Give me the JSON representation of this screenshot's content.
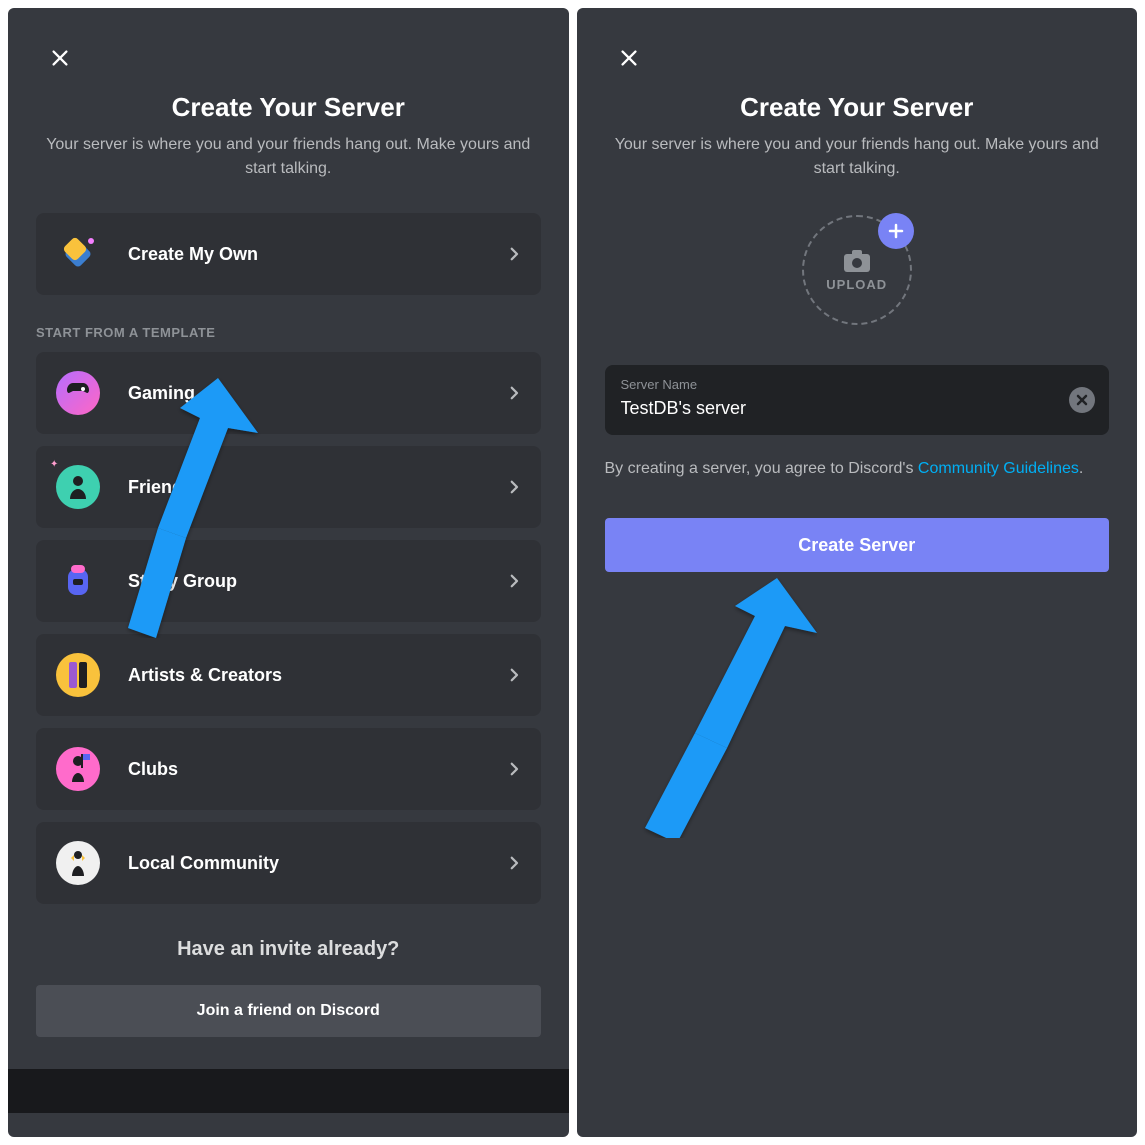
{
  "left": {
    "title": "Create Your Server",
    "subtitle": "Your server is where you and your friends hang out. Make yours and start talking.",
    "create_my_own": "Create My Own",
    "template_header": "START FROM A TEMPLATE",
    "templates": [
      {
        "label": "Gaming"
      },
      {
        "label": "Friends"
      },
      {
        "label": "Study Group"
      },
      {
        "label": "Artists & Creators"
      },
      {
        "label": "Clubs"
      },
      {
        "label": "Local Community"
      }
    ],
    "invite_prompt": "Have an invite already?",
    "join_button": "Join a friend on Discord"
  },
  "right": {
    "title": "Create Your Server",
    "subtitle": "Your server is where you and your friends hang out. Make yours and start talking.",
    "upload_label": "UPLOAD",
    "input_label": "Server Name",
    "input_value": "TestDB's server",
    "agree_prefix": "By creating a server, you agree to Discord's ",
    "agree_link": "Community Guidelines",
    "agree_suffix": ".",
    "create_button": "Create Server"
  },
  "annotation_color": "#1b9af7"
}
